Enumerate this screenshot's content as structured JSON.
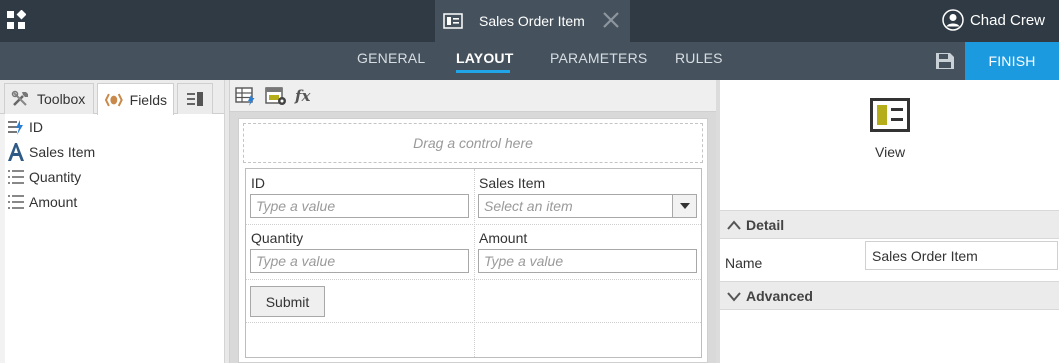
{
  "header": {
    "document_title": "Sales Order Item",
    "user_name": "Chad Crew"
  },
  "nav": {
    "tabs": [
      {
        "label": "GENERAL"
      },
      {
        "label": "LAYOUT"
      },
      {
        "label": "PARAMETERS"
      },
      {
        "label": "RULES"
      }
    ],
    "active_tab": "LAYOUT",
    "finish_label": "FINISH"
  },
  "left_panel": {
    "tabs": [
      {
        "label": "Toolbox",
        "icon": "tools-icon"
      },
      {
        "label": "Fields",
        "icon": "fields-icon"
      }
    ],
    "fields": [
      {
        "label": "ID",
        "icon": "autonumber-icon"
      },
      {
        "label": "Sales Item",
        "icon": "text-icon"
      },
      {
        "label": "Quantity",
        "icon": "number-icon"
      },
      {
        "label": "Amount",
        "icon": "number-icon"
      }
    ]
  },
  "canvas": {
    "drag_hint": "Drag a control here",
    "form": {
      "id_label": "ID",
      "id_placeholder": "Type a value",
      "sales_item_label": "Sales Item",
      "sales_item_placeholder": "Select an item",
      "quantity_label": "Quantity",
      "quantity_placeholder": "Type a value",
      "amount_label": "Amount",
      "amount_placeholder": "Type a value",
      "submit_label": "Submit"
    }
  },
  "right_panel": {
    "view_label": "View",
    "detail_section": "Detail",
    "name_label": "Name",
    "name_value": "Sales Order Item",
    "advanced_section": "Advanced"
  },
  "colors": {
    "topbar": "#2f3a44",
    "navbar": "#45525e",
    "accent": "#1b9ae0",
    "view_icon": "#b5ad1a"
  }
}
